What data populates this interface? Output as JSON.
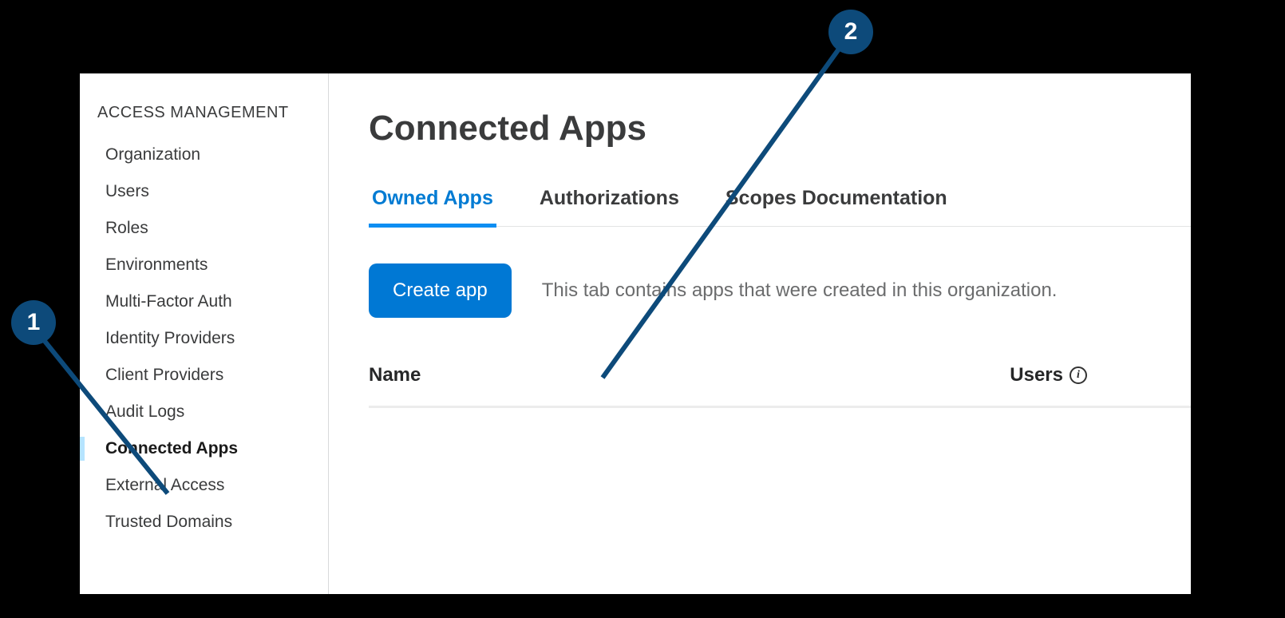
{
  "sidebar": {
    "section_title": "ACCESS MANAGEMENT",
    "items": [
      {
        "label": "Organization"
      },
      {
        "label": "Users"
      },
      {
        "label": "Roles"
      },
      {
        "label": "Environments"
      },
      {
        "label": "Multi-Factor Auth"
      },
      {
        "label": "Identity Providers"
      },
      {
        "label": "Client Providers"
      },
      {
        "label": "Audit Logs"
      },
      {
        "label": "Connected Apps"
      },
      {
        "label": "External Access"
      },
      {
        "label": "Trusted Domains"
      }
    ]
  },
  "main": {
    "page_title": "Connected Apps",
    "tabs": [
      {
        "label": "Owned Apps"
      },
      {
        "label": "Authorizations"
      },
      {
        "label": "Scopes Documentation"
      }
    ],
    "create_button": "Create app",
    "tab_description": "This tab contains apps that were created in this organization.",
    "columns": {
      "name": "Name",
      "users": "Users"
    }
  },
  "callouts": {
    "c1": "1",
    "c2": "2"
  }
}
